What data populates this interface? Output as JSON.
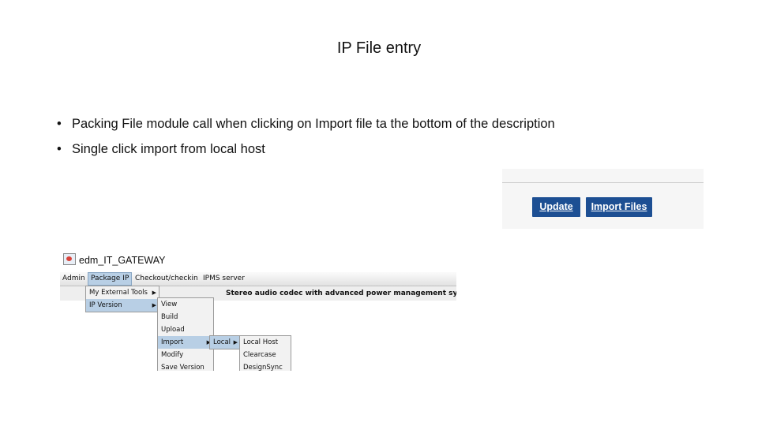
{
  "slide": {
    "title": "IP File entry",
    "bullets": [
      "Packing File module call when clicking on Import file ta the bottom of the description",
      "Single click import from local host"
    ]
  },
  "import_panel": {
    "update_label": "Update",
    "import_label": "Import Files",
    "button_color": "#1d4f93"
  },
  "app_window": {
    "title": "edm_IT_GATEWAY",
    "menubar": [
      "Admin",
      "Package IP",
      "Checkout/checkin",
      "IPMS server"
    ],
    "description": "Stereo audio codec with advanced power management syste",
    "package_menu": [
      "My External Tools",
      "IP Version"
    ],
    "ip_version_menu": [
      "View",
      "Build",
      "Upload",
      "Import",
      "Modify",
      "Save Version"
    ],
    "import_menu": [
      "Local"
    ],
    "local_menu": [
      "Local Host",
      "Clearcase",
      "DesignSync"
    ],
    "highlight_color": "#b8cfe5"
  }
}
